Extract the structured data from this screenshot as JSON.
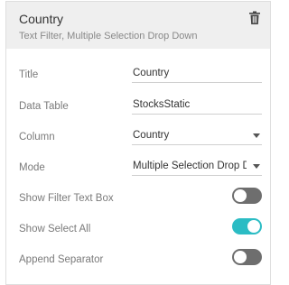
{
  "header": {
    "title": "Country",
    "subtitle": "Text Filter, Multiple Selection Drop Down",
    "delete_icon": "trash-icon"
  },
  "fields": {
    "title": {
      "label": "Title",
      "value": "Country"
    },
    "data_table": {
      "label": "Data Table",
      "value": "StocksStatic"
    },
    "column": {
      "label": "Column",
      "value": "Country"
    },
    "mode": {
      "label": "Mode",
      "value": "Multiple Selection Drop Down"
    }
  },
  "toggles": {
    "show_filter_text_box": {
      "label": "Show Filter Text Box",
      "on": false
    },
    "show_select_all": {
      "label": "Show Select All",
      "on": true
    },
    "append_separator": {
      "label": "Append Separator",
      "on": false
    }
  },
  "colors": {
    "toggle_on": "#2bbcc4",
    "toggle_off": "#6e6e6e",
    "header_bg": "#efefef"
  }
}
